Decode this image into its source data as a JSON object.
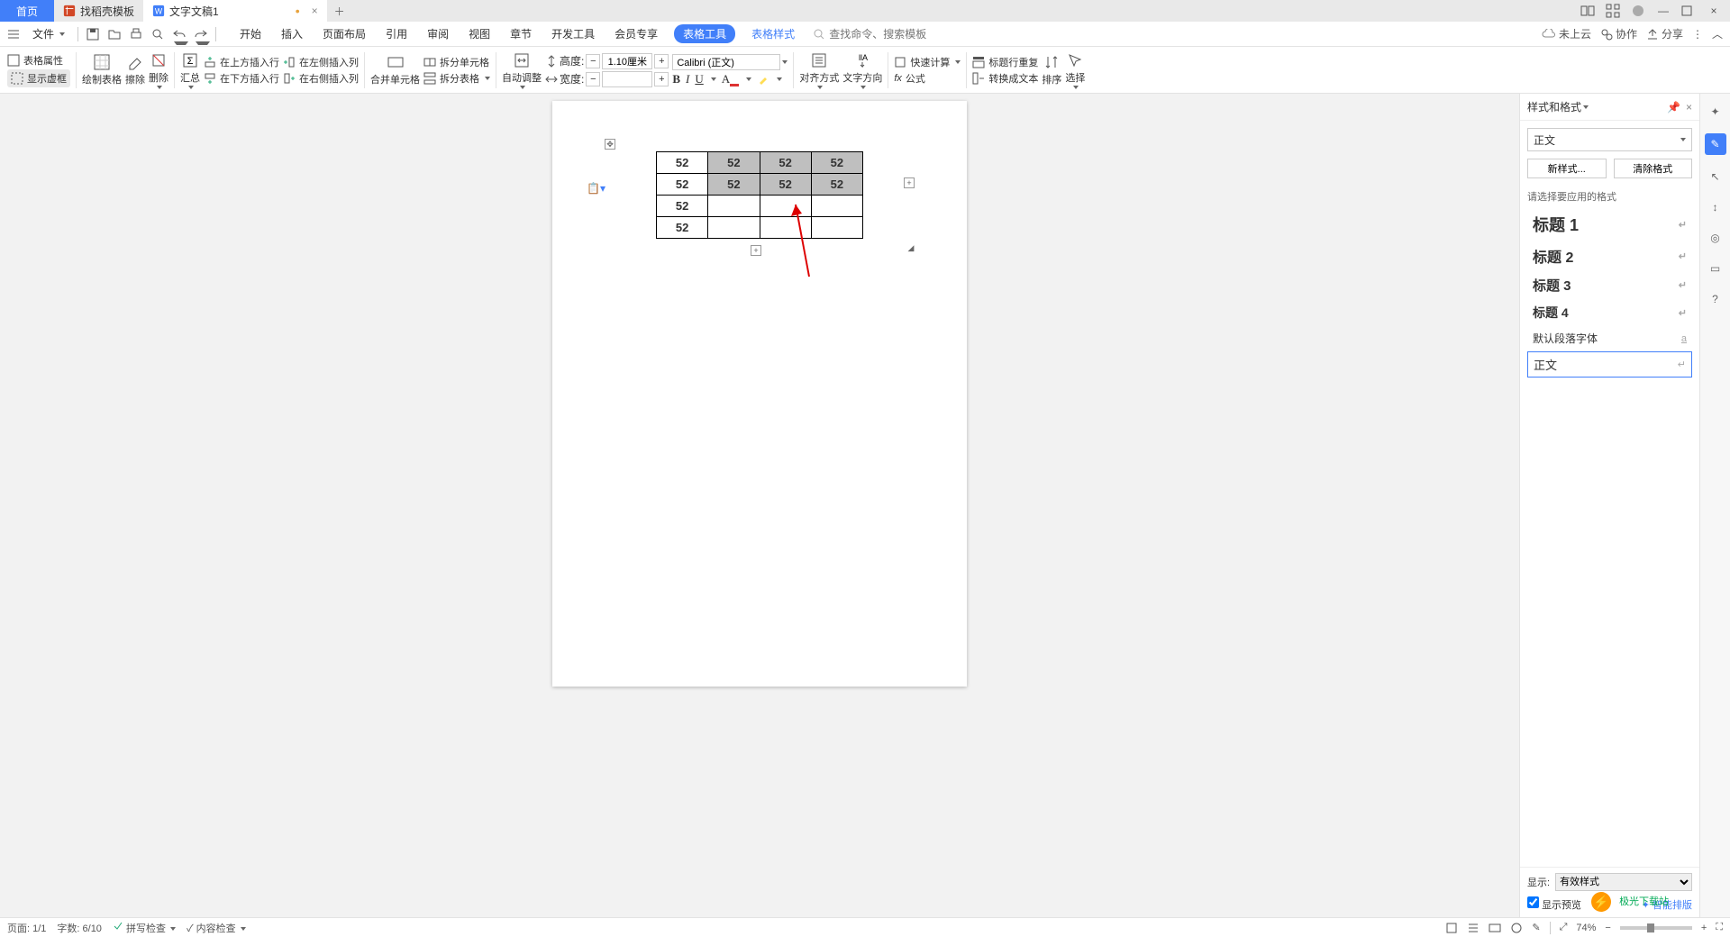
{
  "tabs": {
    "home": "首页",
    "t1": "找稻壳模板",
    "t2": "文字文稿1"
  },
  "file_label": "文件",
  "menu": {
    "start": "开始",
    "insert": "插入",
    "layout": "页面布局",
    "ref": "引用",
    "review": "审阅",
    "view": "视图",
    "chapter": "章节",
    "dev": "开发工具",
    "member": "会员专享",
    "tabletool": "表格工具",
    "tablestyle": "表格样式"
  },
  "search": {
    "placeholder": "查找命令、搜索模板"
  },
  "cloud": {
    "label": "未上云",
    "coop": "协作",
    "share": "分享"
  },
  "ribbon": {
    "props": "表格属性",
    "showframe": "显示虚框",
    "drawtable": "绘制表格",
    "eraser": "擦除",
    "delete": "删除",
    "summary": "汇总",
    "insabove": "在上方插入行",
    "insbelow": "在下方插入行",
    "insleft": "在左侧插入列",
    "insright": "在右侧插入列",
    "merge": "合并单元格",
    "splitcell": "拆分单元格",
    "splittable": "拆分表格",
    "autofit": "自动调整",
    "height": "高度:",
    "width": "宽度:",
    "height_val": "1.10厘米",
    "font": "Calibri (正文)",
    "align": "对齐方式",
    "textdir": "文字方向",
    "quickcalc": "快速计算",
    "formula": "公式",
    "headerrepeat": "标题行重复",
    "converttext": "转换成文本",
    "sort": "排序",
    "select": "选择"
  },
  "chart_data": {
    "type": "table",
    "rows": [
      [
        "52",
        "52",
        "52",
        "52"
      ],
      [
        "52",
        "52",
        "52",
        "52"
      ],
      [
        "52",
        "",
        "",
        ""
      ],
      [
        "52",
        "",
        "",
        ""
      ]
    ],
    "shaded_cells": [
      [
        0,
        1
      ],
      [
        0,
        2
      ],
      [
        0,
        3
      ],
      [
        1,
        1
      ],
      [
        1,
        2
      ],
      [
        1,
        3
      ]
    ]
  },
  "panel": {
    "title": "样式和格式",
    "current": "正文",
    "newstyle": "新样式...",
    "clear": "清除格式",
    "hint": "请选择要应用的格式",
    "styles": {
      "h1": "标题 1",
      "h2": "标题 2",
      "h3": "标题 3",
      "h4": "标题 4",
      "para": "默认段落字体",
      "body": "正文"
    },
    "show": "显示:",
    "show_val": "有效样式",
    "preview": "显示预览",
    "smart": "智能排版"
  },
  "status": {
    "page": "页面: 1/1",
    "words": "字数: 6/10",
    "spell": "拼写检查",
    "content": "内容检查",
    "zoom": "74%"
  },
  "corner": {
    "brand": "极光下载站"
  }
}
